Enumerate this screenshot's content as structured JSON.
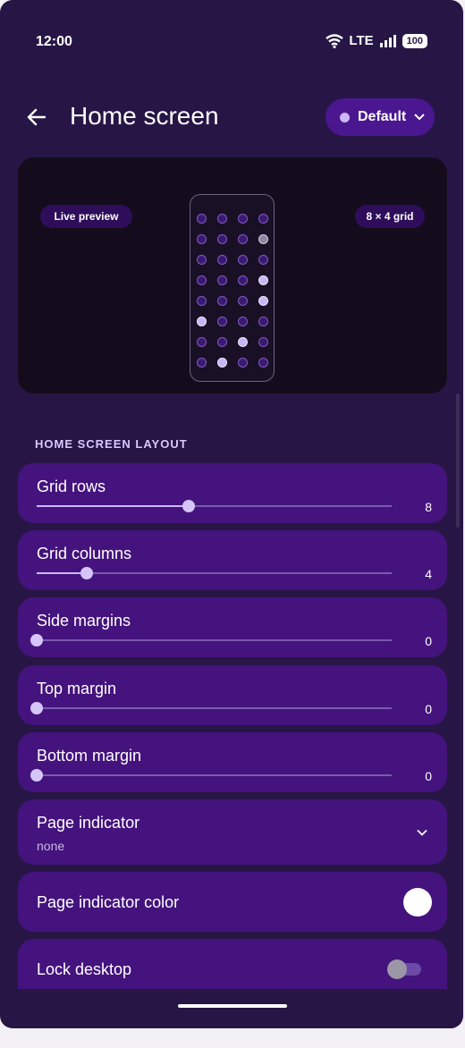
{
  "status_bar": {
    "time": "12:00",
    "network": "LTE",
    "battery": "100"
  },
  "header": {
    "title": "Home screen",
    "profile_label": "Default"
  },
  "preview": {
    "left_pill": "Live preview",
    "right_pill": "8 × 4 grid"
  },
  "section": {
    "title": "HOME SCREEN LAYOUT"
  },
  "settings": {
    "grid_rows": {
      "label": "Grid rows",
      "value": "8",
      "fraction": 0.43
    },
    "grid_columns": {
      "label": "Grid columns",
      "value": "4",
      "fraction": 0.14
    },
    "side_margins": {
      "label": "Side margins",
      "value": "0",
      "fraction": 0
    },
    "top_margin": {
      "label": "Top margin",
      "value": "0",
      "fraction": 0
    },
    "bottom_margin": {
      "label": "Bottom margin",
      "value": "0",
      "fraction": 0
    },
    "page_indicator": {
      "label": "Page indicator",
      "value": "none"
    },
    "page_indicator_color": {
      "label": "Page indicator color",
      "color": "#ffffff"
    },
    "lock_desktop": {
      "label": "Lock desktop",
      "enabled": false
    }
  },
  "colors": {
    "accent": "#cbb8f5",
    "card": "#44137d",
    "background": "#271645"
  }
}
